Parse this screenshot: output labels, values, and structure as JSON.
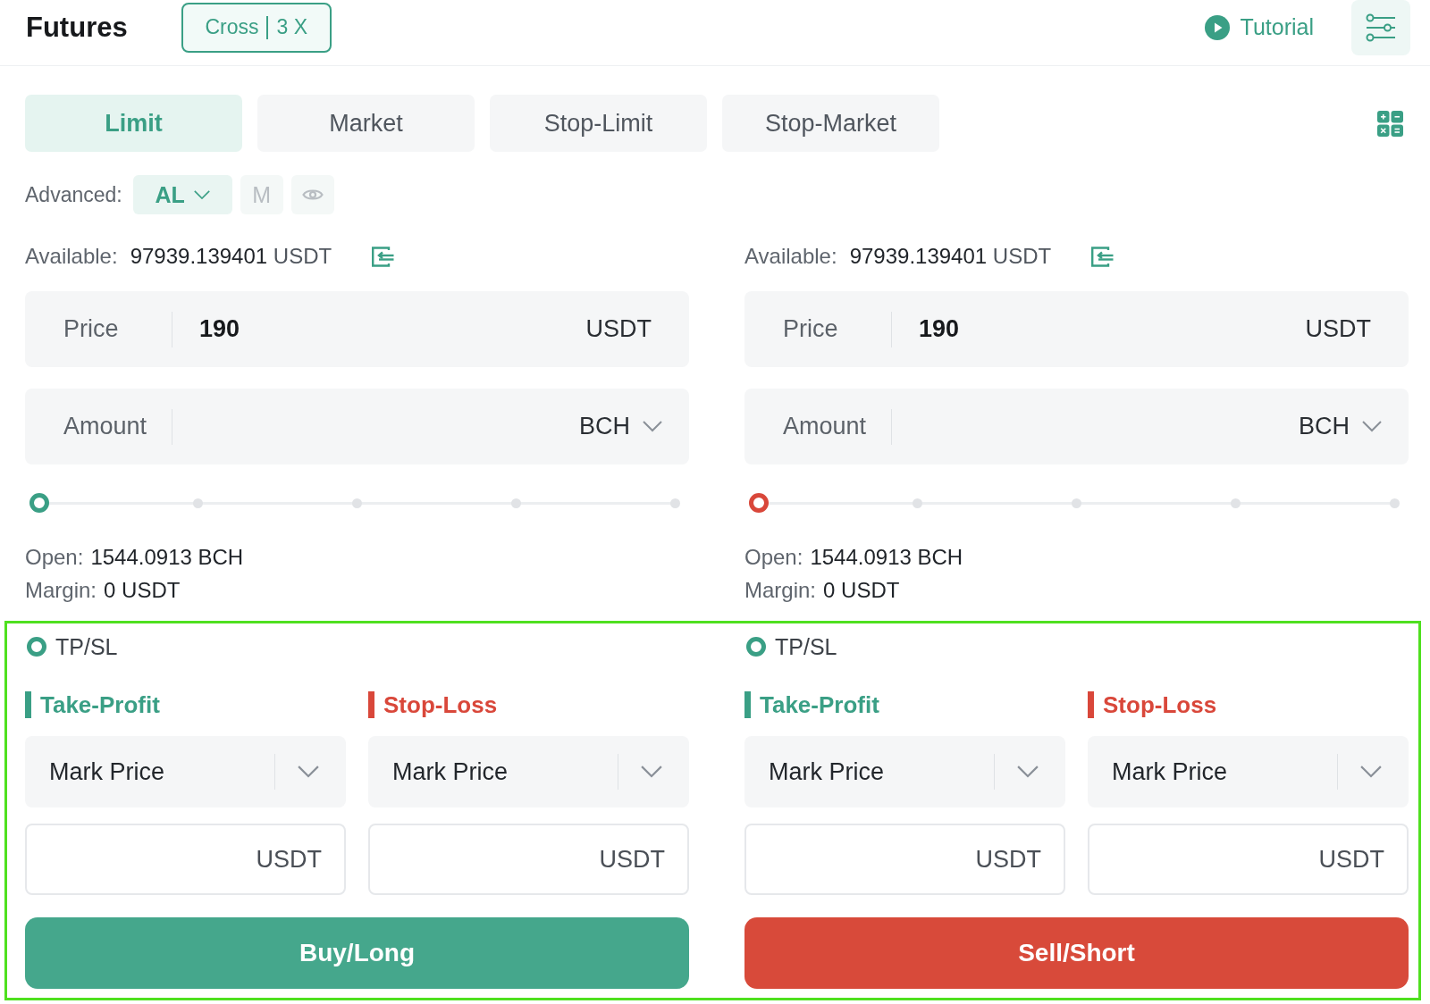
{
  "header": {
    "title": "Futures",
    "margin_mode": "Cross",
    "leverage": "3 X",
    "tutorial": "Tutorial"
  },
  "order_types": [
    {
      "label": "Limit",
      "selected": true
    },
    {
      "label": "Market",
      "selected": false
    },
    {
      "label": "Stop-Limit",
      "selected": false
    },
    {
      "label": "Stop-Market",
      "selected": false
    }
  ],
  "advanced": {
    "label": "Advanced:",
    "options": [
      {
        "kind": "dropdown",
        "label": "AL",
        "selected": true
      },
      {
        "kind": "text",
        "label": "M",
        "selected": false
      },
      {
        "kind": "eye",
        "selected": false
      }
    ]
  },
  "panels": [
    {
      "kind": "buy",
      "available": {
        "label": "Available:",
        "value": "97939.139401",
        "unit": "USDT"
      },
      "price": {
        "label": "Price",
        "value": "190",
        "unit": "USDT"
      },
      "amount": {
        "label": "Amount",
        "unit": "BCH"
      },
      "slider": {
        "level": 0
      },
      "open": {
        "label": "Open:",
        "value": "1544.0913 BCH"
      },
      "margin": {
        "label": "Margin:",
        "value": "0 USDT"
      },
      "tpsl": {
        "label": "TP/SL",
        "checked": true,
        "legs": [
          {
            "kind": "take_profit",
            "title": "Take-Profit",
            "trigger": "Mark Price",
            "unit": "USDT"
          },
          {
            "kind": "stop_loss",
            "title": "Stop-Loss",
            "trigger": "Mark Price",
            "unit": "USDT"
          }
        ]
      },
      "submit": "Buy/Long"
    },
    {
      "kind": "sell",
      "available": {
        "label": "Available:",
        "value": "97939.139401",
        "unit": "USDT"
      },
      "price": {
        "label": "Price",
        "value": "190",
        "unit": "USDT"
      },
      "amount": {
        "label": "Amount",
        "unit": "BCH"
      },
      "slider": {
        "level": 0
      },
      "open": {
        "label": "Open:",
        "value": "1544.0913 BCH"
      },
      "margin": {
        "label": "Margin:",
        "value": "0 USDT"
      },
      "tpsl": {
        "label": "TP/SL",
        "checked": true,
        "legs": [
          {
            "kind": "take_profit",
            "title": "Take-Profit",
            "trigger": "Mark Price",
            "unit": "USDT"
          },
          {
            "kind": "stop_loss",
            "title": "Stop-Loss",
            "trigger": "Mark Price",
            "unit": "USDT"
          }
        ]
      },
      "submit": "Sell/Short"
    }
  ],
  "tpsl_highlighted": true
}
